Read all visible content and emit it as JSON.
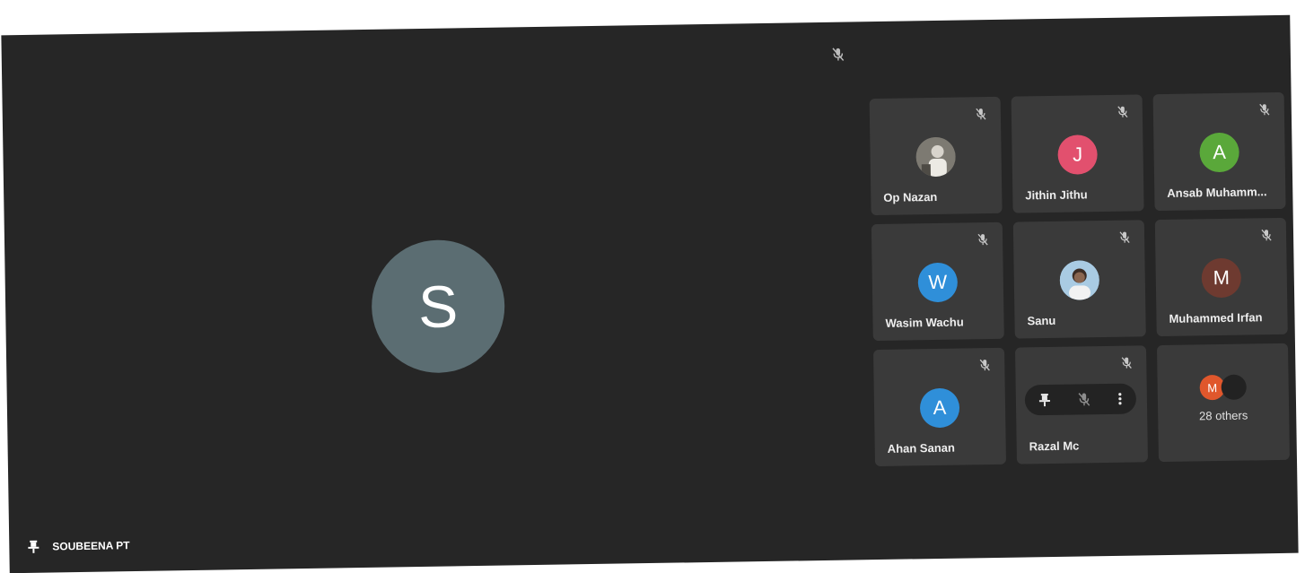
{
  "main": {
    "speaker_initial": "S",
    "speaker_avatar_color": "#5b6d72",
    "pinned_icon": "pin-icon",
    "pinned_name": "SOUBEENA PT",
    "muted_icon": "mic-off-icon"
  },
  "tiles": [
    {
      "name": "Op Nazan",
      "initial": "",
      "color": "#6b6b66",
      "avatar_type": "photo",
      "icon": "mic-off-icon"
    },
    {
      "name": "Jithin Jithu",
      "initial": "J",
      "color": "#e2506e",
      "avatar_type": "letter",
      "icon": "mic-off-icon"
    },
    {
      "name": "Ansab Muhamm...",
      "initial": "A",
      "color": "#5aa83a",
      "avatar_type": "letter",
      "icon": "mic-off-icon"
    },
    {
      "name": "Wasim Wachu",
      "initial": "W",
      "color": "#2f8fd9",
      "avatar_type": "letter",
      "icon": "mic-off-icon"
    },
    {
      "name": "Sanu",
      "initial": "",
      "color": "#8fb8d8",
      "avatar_type": "photo",
      "icon": "mic-off-icon"
    },
    {
      "name": "Muhammed Irfan",
      "initial": "M",
      "color": "#6e3a30",
      "avatar_type": "letter",
      "icon": "mic-off-icon"
    },
    {
      "name": "Ahan Sanan",
      "initial": "A",
      "color": "#2f8fd9",
      "avatar_type": "letter",
      "icon": "mic-off-icon"
    },
    {
      "name": "Razal Mc",
      "initial": "",
      "color": "#3a3a3a",
      "avatar_type": "hover",
      "icon": "mic-off-icon",
      "hover_icons": [
        "pin-icon",
        "mic-off-icon",
        "more-vert-icon"
      ]
    }
  ],
  "others": {
    "label": "28 others",
    "avatars": [
      {
        "initial": "M",
        "color": "#e0572c"
      },
      {
        "initial": "",
        "color": "#222222"
      }
    ]
  }
}
